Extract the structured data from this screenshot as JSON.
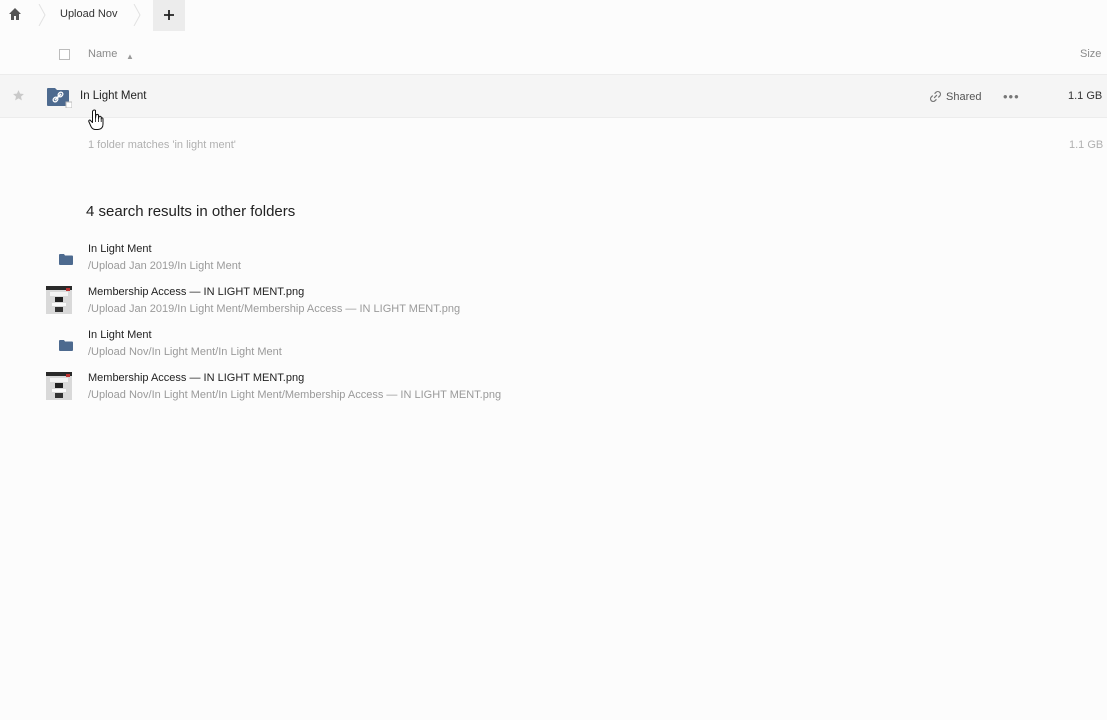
{
  "breadcrumb": {
    "current_folder": "Upload Nov",
    "add_label": "+"
  },
  "header": {
    "name_label": "Name",
    "sort_indicator": "▲",
    "size_label": "Size"
  },
  "main_row": {
    "name": "In Light Ment",
    "shared_label": "Shared",
    "more_label": "•••",
    "size": "1.1 GB"
  },
  "summary": {
    "text": "1 folder matches 'in light ment'",
    "size": "1.1 GB"
  },
  "other_results": {
    "title": "4 search results in other folders",
    "items": [
      {
        "type": "folder",
        "name": "In Light Ment",
        "path": "/Upload Jan 2019/In Light Ment"
      },
      {
        "type": "image",
        "name": "Membership Access — IN LIGHT MENT.png",
        "path": "/Upload Jan 2019/In Light Ment/Membership Access — IN LIGHT MENT.png"
      },
      {
        "type": "folder",
        "name": "In Light Ment",
        "path": "/Upload Nov/In Light Ment/In Light Ment"
      },
      {
        "type": "image",
        "name": "Membership Access — IN LIGHT MENT.png",
        "path": "/Upload Nov/In Light Ment/In Light Ment/Membership Access — IN LIGHT MENT.png"
      }
    ]
  },
  "icons": {
    "home": "home-icon",
    "star": "star-icon",
    "folder_shared": "shared-folder-icon",
    "link": "link-icon",
    "folder": "folder-icon",
    "thumbnail": "image-thumbnail"
  },
  "colors": {
    "folder": "#4d6a8f",
    "selected_row": "#f5f5f5"
  }
}
